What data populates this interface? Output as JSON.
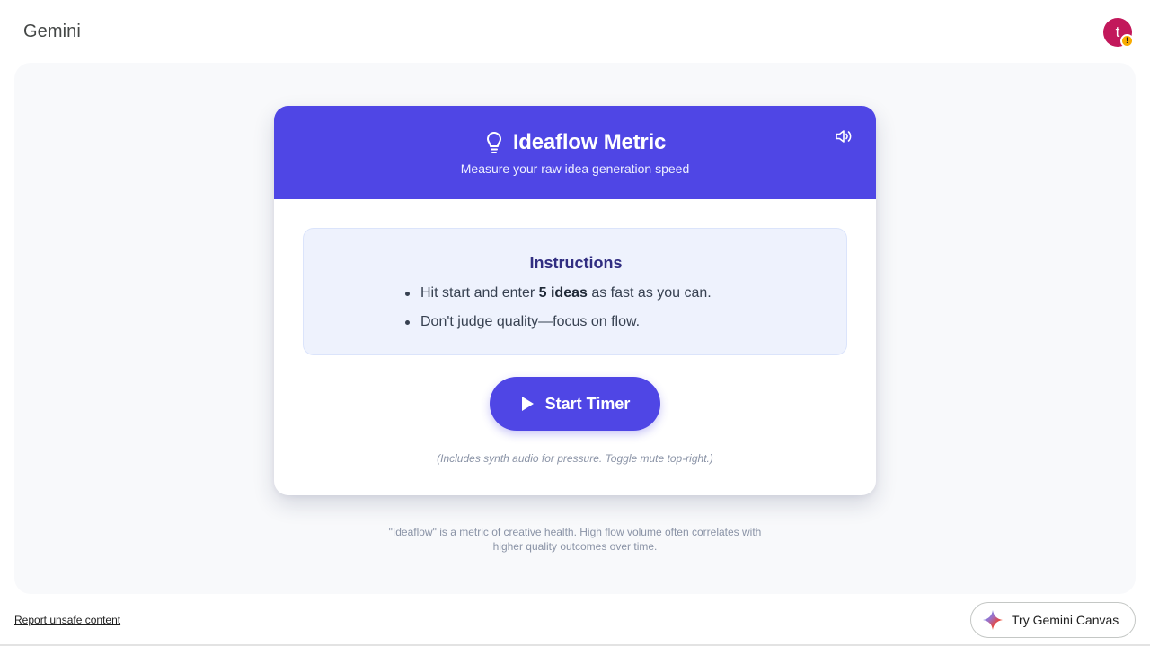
{
  "app": {
    "brand": "Gemini",
    "avatar_initial": "t",
    "avatar_badge": "!"
  },
  "card": {
    "title": "Ideaflow Metric",
    "subtitle": "Measure your raw idea generation speed",
    "instructions": {
      "title": "Instructions",
      "item1_pre": "Hit start and enter ",
      "item1_bold": "5 ideas",
      "item1_post": " as fast as you can.",
      "item2": "Don't judge quality—focus on flow."
    },
    "start_button_label": "Start Timer",
    "note": "(Includes synth audio for pressure. Toggle mute top-right.)"
  },
  "footer_note_line1": "\"Ideaflow\" is a metric of creative health. High flow volume often correlates with",
  "footer_note_line2": "higher quality outcomes over time.",
  "bottom": {
    "report_link": "Report unsafe content",
    "canvas_button_label": "Try Gemini Canvas"
  },
  "colors": {
    "header_bg": "#4f46e5",
    "button_bg": "#4f46e5",
    "instructions_bg": "#eef2fd",
    "avatar_bg": "#c2185b"
  },
  "icons": {
    "title_icon": "lightbulb-icon",
    "mute_icon": "speaker-icon",
    "start_icon": "play-icon",
    "canvas_icon": "gemini-spark-icon"
  }
}
